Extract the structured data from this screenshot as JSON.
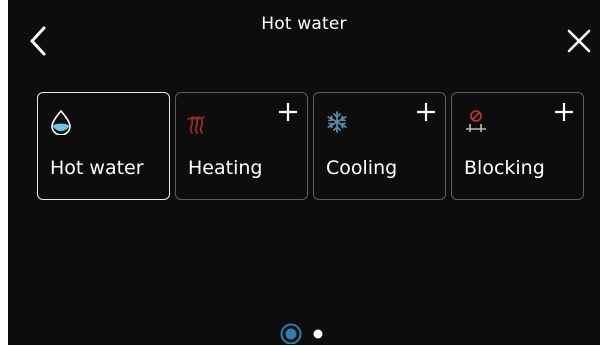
{
  "header": {
    "title": "Hot water",
    "back_icon": "chevron-left-icon",
    "close_icon": "close-icon"
  },
  "tiles": [
    {
      "label": "Hot water",
      "icon": "water-drop-icon",
      "selected": true,
      "has_add": false
    },
    {
      "label": "Heating",
      "icon": "heating-icon",
      "selected": false,
      "has_add": true
    },
    {
      "label": "Cooling",
      "icon": "snowflake-icon",
      "selected": false,
      "has_add": true
    },
    {
      "label": "Blocking",
      "icon": "blocking-icon",
      "selected": false,
      "has_add": true
    }
  ],
  "pagination": {
    "pages": 2,
    "current": 1
  },
  "colors": {
    "background": "#0d0d0d",
    "water_icon": "#6cc3e6",
    "heating_icon": "#9a2e20",
    "cooling_icon": "#5b8aa6",
    "blocking_icon": "#c0392b",
    "page_indicator_active": "#2d7fb6"
  }
}
